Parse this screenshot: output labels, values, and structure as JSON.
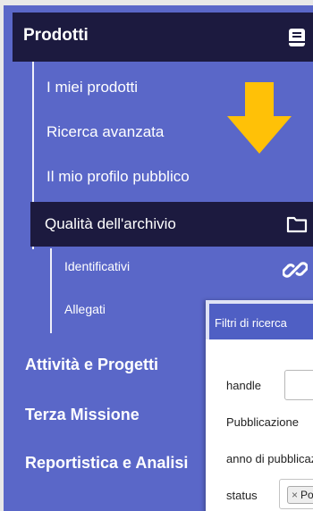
{
  "sidebar": {
    "header": {
      "label": "Prodotti",
      "icon": "book-icon"
    },
    "items": [
      {
        "label": "I miei prodotti"
      },
      {
        "label": "Ricerca avanzata"
      },
      {
        "label": "Il mio profilo pubblico"
      },
      {
        "label": "Qualità dell'archivio",
        "icon": "folder-icon",
        "active": true
      }
    ],
    "subitems": [
      {
        "label": "Identificativi",
        "icon": "link-icon"
      },
      {
        "label": "Allegati"
      }
    ],
    "sections": [
      {
        "label": "Attività e Progetti"
      },
      {
        "label": "Terza Missione"
      },
      {
        "label": "Reportistica e Analisi"
      }
    ]
  },
  "annotation": {
    "icon": "down-arrow-icon",
    "color": "#ffc107"
  },
  "filters": {
    "title": "Filtri di ricerca",
    "handle_label": "handle",
    "pubblicazione_label": "Pubblicazione",
    "anno_label": "anno di pubblicazione",
    "status_label": "status",
    "status_tag": "Pot",
    "status_tag_remove": "×"
  },
  "colors": {
    "sidebar_bg": "#5a67c8",
    "active_bg": "#1c1a3f",
    "panel_header_bg": "#4f5fc4"
  }
}
